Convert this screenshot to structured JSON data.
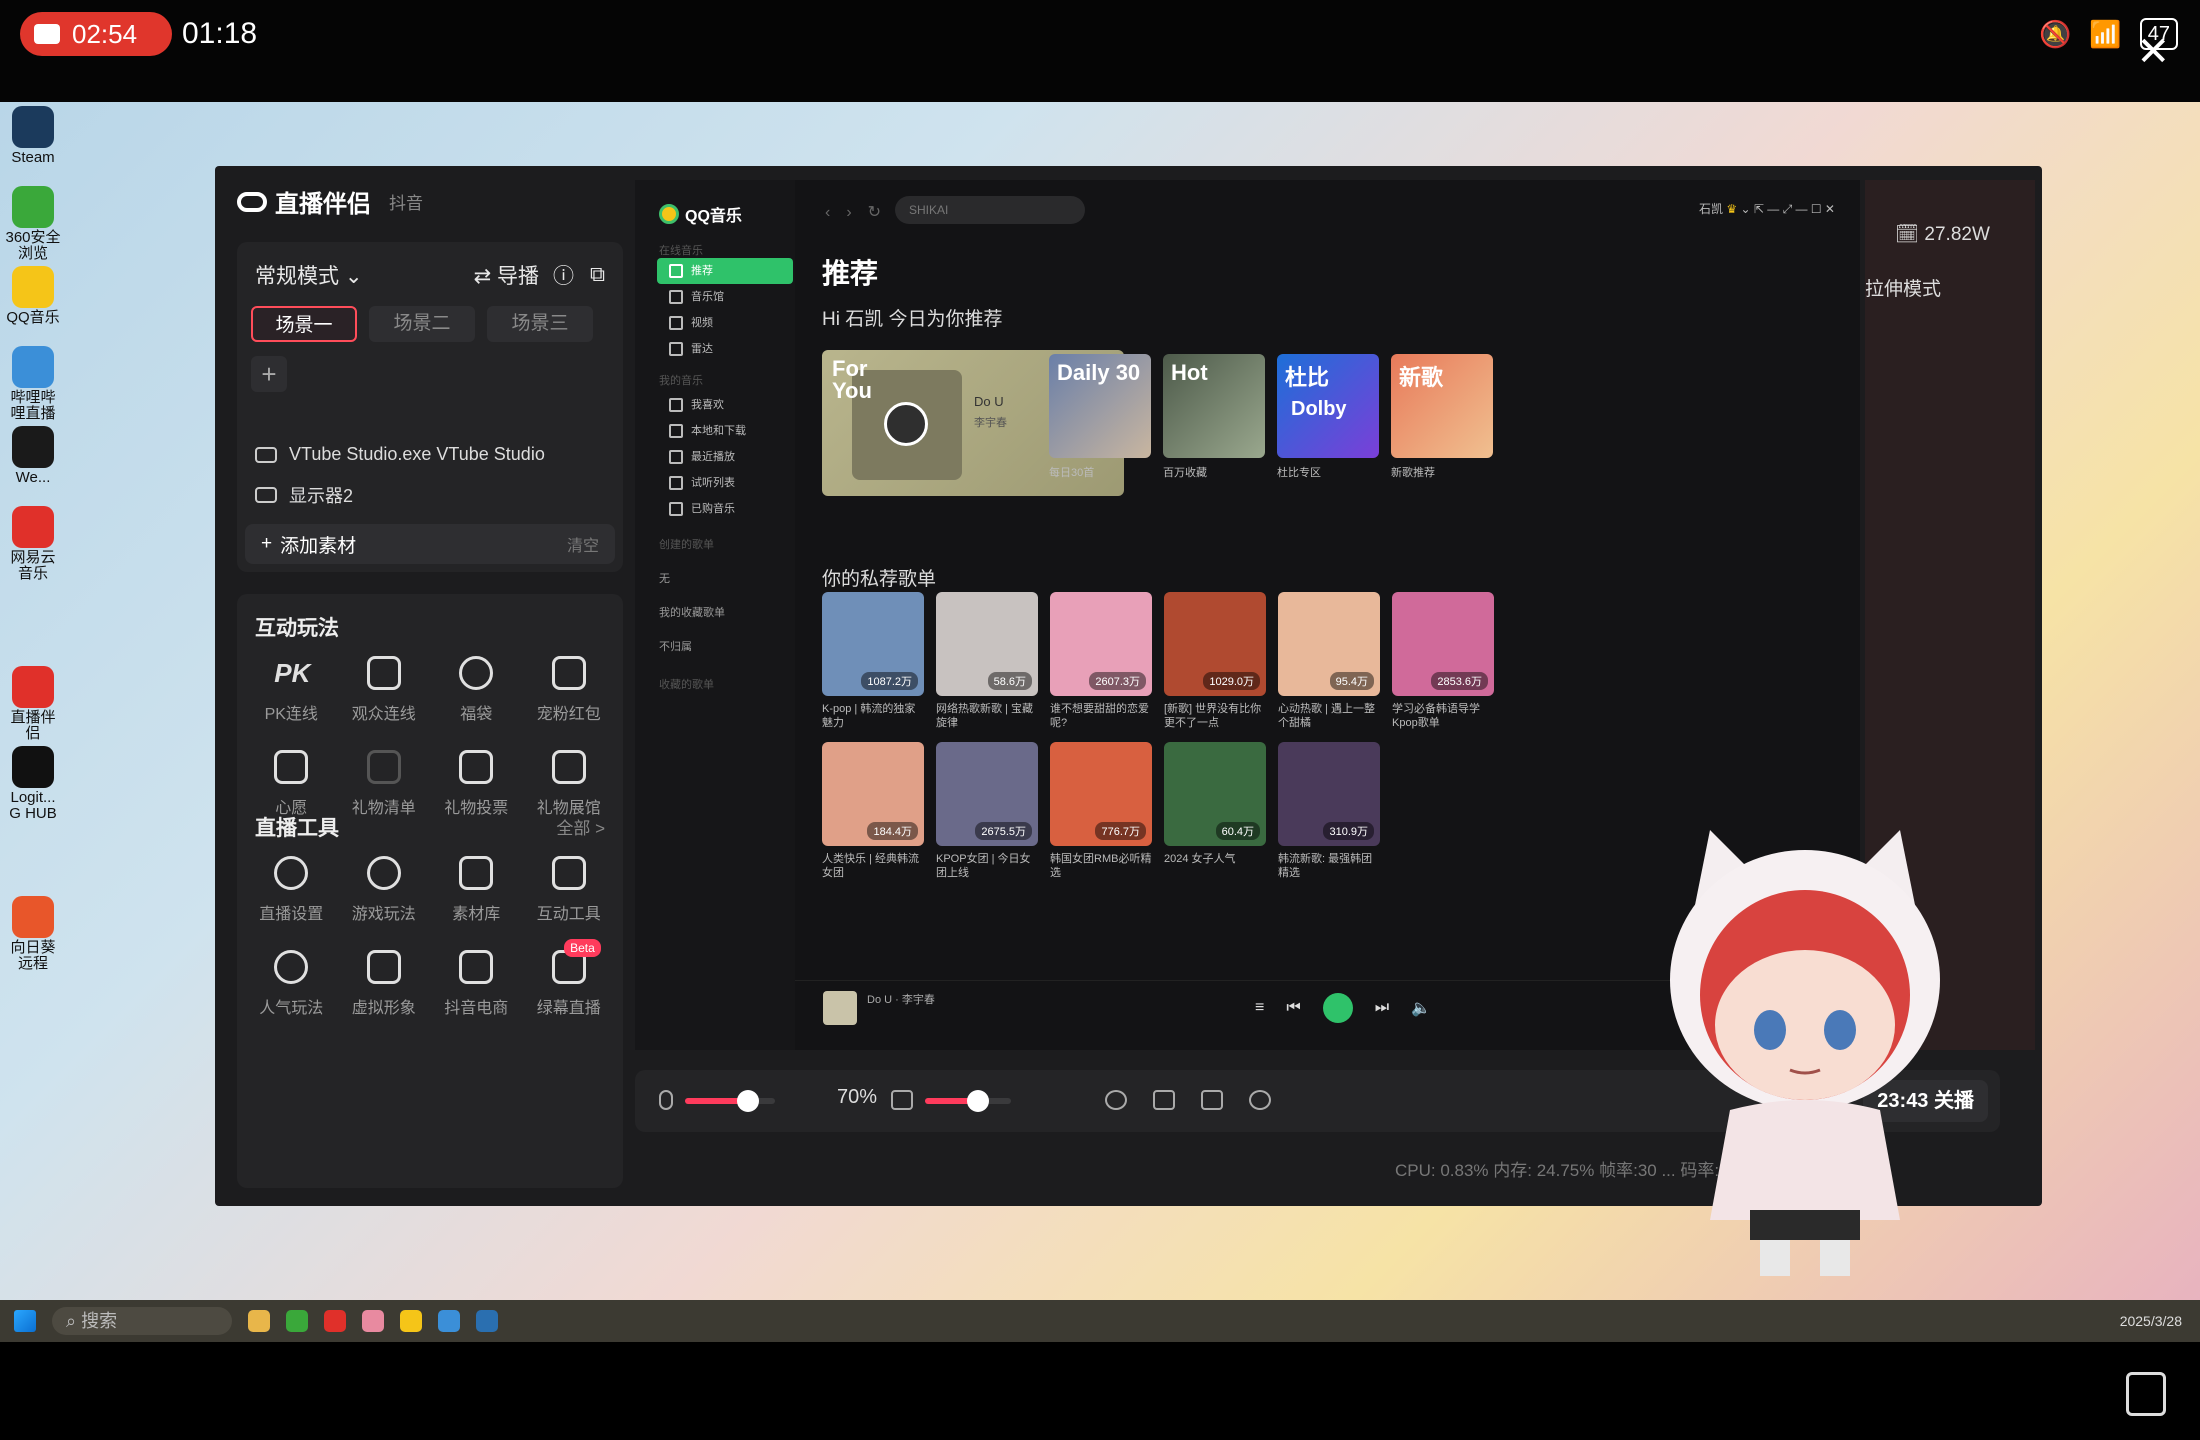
{
  "phone": {
    "record_time": "02:54",
    "clock": "01:18",
    "battery": "47"
  },
  "desktop": {
    "icons": [
      {
        "label": "Steam",
        "color": "#1b3a5c"
      },
      {
        "label": "360安全浏览",
        "color": "#3aa83a"
      },
      {
        "label": "QQ音乐",
        "color": "#f5c518"
      },
      {
        "label": "哔哩哔哩直播",
        "color": "#3b8fd8"
      },
      {
        "label": "We...",
        "color": "#1a1a1a"
      },
      {
        "label": "网易云音乐",
        "color": "#e0302a"
      },
      {
        "label": "直播伴侣",
        "color": "#e0302a"
      },
      {
        "label": "Logit... G HUB",
        "color": "#111111"
      },
      {
        "label": "向日葵远程",
        "color": "#e8562a"
      }
    ],
    "taskbar_search": "搜索",
    "tray_date": "2025/3/28"
  },
  "app": {
    "title": "直播伴侣",
    "subtitle": "抖音",
    "mode": "常规模式",
    "guide": "导播",
    "scenes": [
      "场景一",
      "场景二",
      "场景三"
    ],
    "sources": [
      "VTube Studio.exe VTube Studio",
      "显示器2"
    ],
    "add_material": "添加素材",
    "clear": "清空",
    "interactive_title": "互动玩法",
    "interactive_tools": [
      {
        "label": "PK连线",
        "icon": "pk-icon"
      },
      {
        "label": "观众连线",
        "icon": "audience-link-icon"
      },
      {
        "label": "福袋",
        "icon": "lucky-bag-icon"
      },
      {
        "label": "宠粉红包",
        "icon": "red-envelope-icon"
      },
      {
        "label": "心愿",
        "icon": "wish-icon"
      },
      {
        "label": "礼物清单",
        "icon": "gift-list-icon"
      },
      {
        "label": "礼物投票",
        "icon": "gift-vote-icon"
      },
      {
        "label": "礼物展馆",
        "icon": "gift-gallery-icon"
      }
    ],
    "live_tools_title": "直播工具",
    "live_tools_more": "全部 >",
    "live_tools": [
      {
        "label": "直播设置",
        "icon": "settings-icon"
      },
      {
        "label": "游戏玩法",
        "icon": "game-icon"
      },
      {
        "label": "素材库",
        "icon": "material-library-icon"
      },
      {
        "label": "互动工具",
        "icon": "interactive-tool-icon"
      },
      {
        "label": "人气玩法",
        "icon": "popularity-icon"
      },
      {
        "label": "虚拟形象",
        "icon": "avatar-icon"
      },
      {
        "label": "抖音电商",
        "icon": "cart-icon"
      },
      {
        "label": "绿幕直播",
        "icon": "green-screen-icon",
        "badge": "Beta"
      }
    ],
    "volume_pct": "70%",
    "viewer_count": "27.82W",
    "stretch_mode": "拉伸模式",
    "end_button": "23:43 关播",
    "stats": "CPU: 0.83%   内存: 24.75%   帧率:30   ...   码率: 1543kb/s"
  },
  "music": {
    "logo": "QQ音乐",
    "search": "SHIKAI",
    "user": "石凯",
    "sidebar": {
      "section_online": "在线音乐",
      "items": [
        "推荐",
        "音乐馆",
        "视频",
        "雷达"
      ],
      "section_mine": "我的音乐",
      "my_items": [
        "我喜欢",
        "本地和下载",
        "最近播放",
        "试听列表",
        "已购音乐"
      ],
      "section_created": "创建的歌单",
      "created_items": [
        "无",
        "我的收藏歌单",
        "不归属"
      ],
      "section_collected": "收藏的歌单"
    },
    "title": "推荐",
    "greeting": "Hi 石凯 今日为你推荐",
    "for_you": {
      "tag": "For You",
      "song": "Do U",
      "artist": "李宇春"
    },
    "daily": [
      {
        "tag": "Daily 30",
        "caption": "每日30首"
      },
      {
        "tag": "Hot",
        "caption": "百万收藏"
      },
      {
        "tag": "杜比",
        "caption": "杜比专区",
        "brand": "Dolby"
      },
      {
        "tag": "新歌",
        "caption": "新歌推荐"
      }
    ],
    "private_title": "你的私荐歌单",
    "private_row1": [
      {
        "caption": "K-pop | 韩流的独家魅力",
        "count": "1087.2万"
      },
      {
        "caption": "网络热歌新歌 | 宝藏旋律",
        "count": "58.6万"
      },
      {
        "caption": "谁不想要甜甜的恋爱呢?",
        "count": "2607.3万"
      },
      {
        "caption": "[新歌] 世界没有比你更不了一点",
        "count": "1029.0万"
      },
      {
        "caption": "心动热歌 | 遇上一整个甜橘",
        "count": "95.4万"
      },
      {
        "caption": "学习必备韩语导学Kpop歌单",
        "count": "2853.6万"
      }
    ],
    "private_row2": [
      {
        "caption": "人类快乐 | 经典韩流女团",
        "count": "184.4万"
      },
      {
        "caption": "KPOP女团 | 今日女团上线",
        "count": "2675.5万"
      },
      {
        "caption": "韩国女团RMB必听精选",
        "count": "776.7万"
      },
      {
        "caption": "2024 女子人气",
        "count": "60.4万"
      },
      {
        "caption": "韩流新歌: 最强韩团精选",
        "count": "310.9万"
      }
    ],
    "now_playing": "Do U · 李宇春"
  }
}
